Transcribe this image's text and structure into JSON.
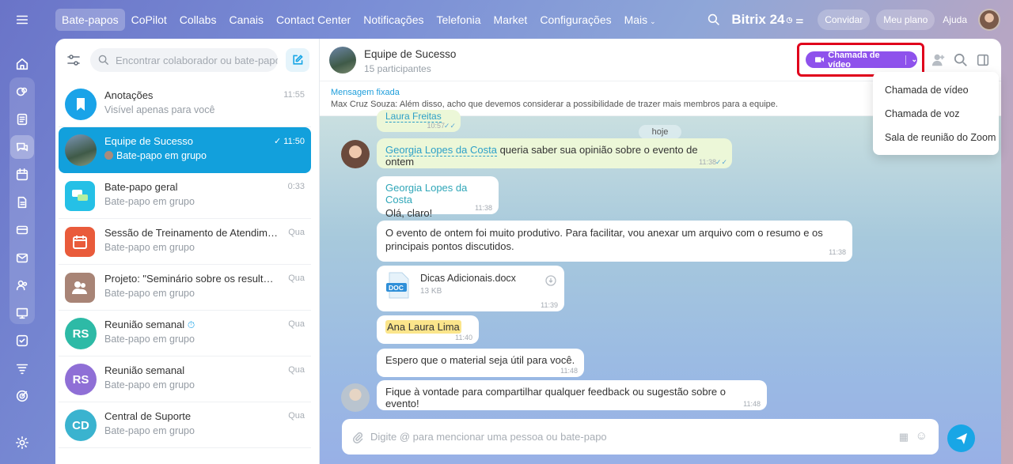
{
  "topnav": {
    "items": [
      "Bate-papos",
      "CoPilot",
      "Collabs",
      "Canais",
      "Contact Center",
      "Notificações",
      "Telefonia",
      "Market",
      "Configurações",
      "Mais"
    ],
    "active": 0
  },
  "topright": {
    "brand": "Bitrix",
    "brand_num": "24",
    "invite": "Convidar",
    "plan": "Meu plano",
    "help": "Ajuda"
  },
  "chatlist": {
    "search_placeholder": "Encontrar colaborador ou bate-papo",
    "items": [
      {
        "name": "Anotações",
        "sub": "Visível apenas para você",
        "time": "11:55",
        "color": "#1aa3e8"
      },
      {
        "name": "Equipe de Sucesso",
        "sub": "Bate-papo em grupo",
        "time": "11:50",
        "color": "#5e7ea0"
      },
      {
        "name": "Bate-papo geral",
        "sub": "Bate-papo em grupo",
        "time": "0:33",
        "color": "#25c0e6"
      },
      {
        "name": "Sessão de Treinamento de Atendiment...",
        "sub": "Bate-papo em grupo",
        "time": "Qua",
        "color": "#e95b3b"
      },
      {
        "name": "Projeto: \"Seminário sobre os resultado...",
        "sub": "Bate-papo em grupo",
        "time": "Qua",
        "color": "#a88476"
      },
      {
        "name": "Reunião semanal",
        "sub": "Bate-papo em grupo",
        "time": "Qua",
        "initials": "RS",
        "color": "#2dbaa6"
      },
      {
        "name": "Reunião semanal",
        "sub": "Bate-papo em grupo",
        "time": "Qua",
        "initials": "RS",
        "color": "#8f6fd6"
      },
      {
        "name": "Central de Suporte",
        "sub": "Bate-papo em grupo",
        "time": "Qua",
        "initials": "CD",
        "color": "#3ab3cf"
      }
    ]
  },
  "chat": {
    "title": "Equipe de Sucesso",
    "subtitle": "15 participantes",
    "call_button": "Chamada de vídeo",
    "pinned_label": "Mensagem fixada",
    "pinned_author": "Max Cruz Souza:",
    "pinned_text": "Além disso, acho que devemos considerar a possibilidade de trazer mais membros para a equipe.",
    "day": "hoje",
    "top_partial": {
      "name": "Laura Freitas",
      "time": "10:57"
    },
    "messages": [
      {
        "mention": "Georgia Lopes da Costa",
        "text": "queria saber sua opinião sobre o evento de ontem",
        "time": "11:38"
      },
      {
        "author": "Georgia Lopes da Costa",
        "text": "Olá, claro!",
        "time": "11:38"
      },
      {
        "text": "O evento de ontem foi muito produtivo. Para facilitar, vou anexar um arquivo com o resumo e os principais pontos discutidos.",
        "time": "11:38"
      },
      {
        "file_name": "Dicas Adicionais.docx",
        "file_size": "13 KB",
        "file_ext": "DOC",
        "time": "11:39"
      },
      {
        "mention": "Ana Laura Lima",
        "time": "11:40"
      },
      {
        "text": "Espero que o material seja útil para você.",
        "time": "11:48"
      },
      {
        "text": "Fique à vontade para compartilhar qualquer feedback ou sugestão sobre o evento!",
        "time": "11:48"
      }
    ],
    "input_placeholder": "Digite @ para mencionar uma pessoa ou bate-papo"
  },
  "dropdown": {
    "items": [
      "Chamada de vídeo",
      "Chamada de voz",
      "Sala de reunião do Zoom"
    ]
  }
}
